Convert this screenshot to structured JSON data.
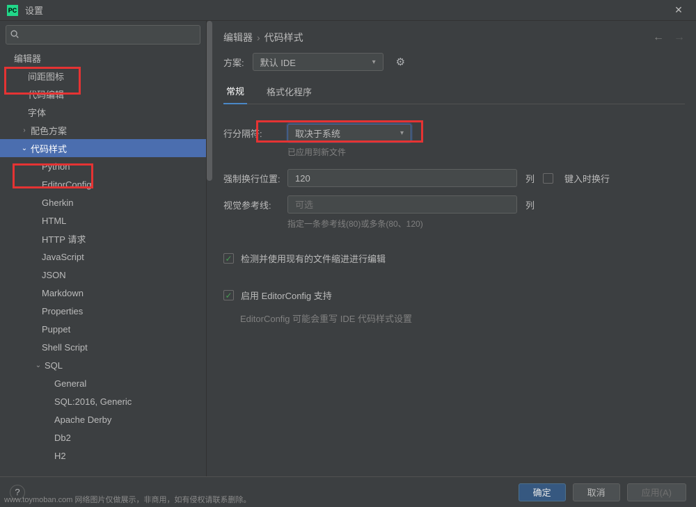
{
  "window": {
    "app_badge": "PC",
    "title": "设置"
  },
  "search": {
    "placeholder": ""
  },
  "sidebar": {
    "section_label": "编辑器",
    "items": [
      {
        "label": "间距图标",
        "level": "l1",
        "chev": "",
        "selected": false
      },
      {
        "label": "代码编辑",
        "level": "l1",
        "chev": "",
        "selected": false
      },
      {
        "label": "字体",
        "level": "l1",
        "chev": "",
        "selected": false
      },
      {
        "label": "配色方案",
        "level": "l1c",
        "chev": "›",
        "selected": false
      },
      {
        "label": "代码样式",
        "level": "l1c",
        "chev": "⌄",
        "selected": true
      },
      {
        "label": "Python",
        "level": "l2",
        "chev": "",
        "selected": false
      },
      {
        "label": "EditorConfig",
        "level": "l2",
        "chev": "",
        "selected": false
      },
      {
        "label": "Gherkin",
        "level": "l2",
        "chev": "",
        "selected": false
      },
      {
        "label": "HTML",
        "level": "l2",
        "chev": "",
        "selected": false
      },
      {
        "label": "HTTP 请求",
        "level": "l2",
        "chev": "",
        "selected": false
      },
      {
        "label": "JavaScript",
        "level": "l2",
        "chev": "",
        "selected": false
      },
      {
        "label": "JSON",
        "level": "l2",
        "chev": "",
        "selected": false
      },
      {
        "label": "Markdown",
        "level": "l2",
        "chev": "",
        "selected": false
      },
      {
        "label": "Properties",
        "level": "l2",
        "chev": "",
        "selected": false
      },
      {
        "label": "Puppet",
        "level": "l2",
        "chev": "",
        "selected": false
      },
      {
        "label": "Shell Script",
        "level": "l2",
        "chev": "",
        "selected": false
      },
      {
        "label": "SQL",
        "level": "l2c",
        "chev": "⌄",
        "selected": false
      },
      {
        "label": "General",
        "level": "l2",
        "chev": "",
        "selected": false,
        "extra_indent": true
      },
      {
        "label": "SQL:2016, Generic",
        "level": "l2",
        "chev": "",
        "selected": false,
        "extra_indent": true
      },
      {
        "label": "Apache Derby",
        "level": "l2",
        "chev": "",
        "selected": false,
        "extra_indent": true
      },
      {
        "label": "Db2",
        "level": "l2",
        "chev": "",
        "selected": false,
        "extra_indent": true
      },
      {
        "label": "H2",
        "level": "l2",
        "chev": "",
        "selected": false,
        "extra_indent": true
      }
    ]
  },
  "breadcrumb": {
    "root": "编辑器",
    "sep": "›",
    "leaf": "代码样式"
  },
  "scheme": {
    "label": "方案:",
    "value": "默认 IDE"
  },
  "tabs": [
    {
      "label": "常规",
      "active": true
    },
    {
      "label": "格式化程序",
      "active": false
    }
  ],
  "form": {
    "line_sep": {
      "label": "行分隔符:",
      "value": "取决于系统",
      "hint": "已应用到新文件"
    },
    "hard_wrap": {
      "label": "强制换行位置:",
      "value": "120",
      "after": "列",
      "checkbox_label": "键入时换行"
    },
    "guides": {
      "label": "视觉参考线:",
      "placeholder": "可选",
      "after": "列",
      "hint": "指定一条参考线(80)或多条(80、120)"
    },
    "detect_indent": {
      "label": "检测并使用现有的文件缩进进行编辑"
    },
    "editorconfig": {
      "label": "启用 EditorConfig 支持",
      "sub": "EditorConfig 可能会重写 IDE 代码样式设置"
    }
  },
  "footer": {
    "ok": "确定",
    "cancel": "取消",
    "apply": "应用(A)"
  },
  "watermark": "www.toymoban.com 网络图片仅做展示，非商用，如有侵权请联系删除。"
}
